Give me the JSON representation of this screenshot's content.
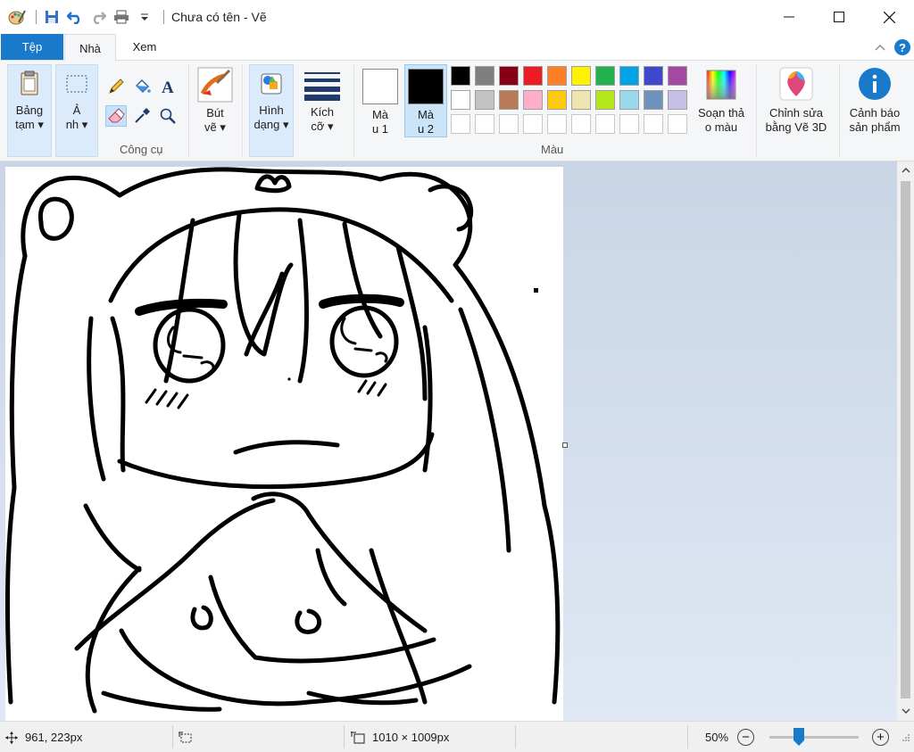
{
  "window": {
    "title": "Chưa có tên - Vẽ"
  },
  "tabs": {
    "file": "Tệp",
    "home": "Nhà",
    "view": "Xem"
  },
  "ribbon": {
    "clipboard": {
      "line1": "Bảng",
      "line2": "tạm"
    },
    "image": {
      "line1": "Ả",
      "line2": "nh"
    },
    "tools_label": "Công cụ",
    "brushes": {
      "line1": "Bút",
      "line2": "vẽ"
    },
    "shapes": {
      "line1": "Hình",
      "line2": "dạng"
    },
    "size": {
      "line1": "Kích",
      "line2": "cỡ"
    },
    "color1": {
      "line1": "Mà",
      "line2": "u 1",
      "value": "#ffffff"
    },
    "color2": {
      "line1": "Mà",
      "line2": "u 2",
      "value": "#000000"
    },
    "colors_label": "Màu",
    "edit_colors": {
      "line1": "Soạn thả",
      "line2": "o màu"
    },
    "edit_3d": {
      "line1": "Chỉnh sửa",
      "line2": "bằng Vẽ 3D"
    },
    "product_alert": {
      "line1": "Cảnh báo",
      "line2": "sản phẩm"
    },
    "palette_row1": [
      "#000000",
      "#7f7f7f",
      "#880015",
      "#ed1c24",
      "#ff7f27",
      "#fff200",
      "#22b14c",
      "#00a2e8",
      "#3f48cc",
      "#a349a4"
    ],
    "palette_row2": [
      "#ffffff",
      "#c3c3c3",
      "#b97a57",
      "#ffaec9",
      "#ffc90e",
      "#efe4b0",
      "#b5e61d",
      "#99d9ea",
      "#7092be",
      "#c8bfe7"
    ],
    "palette_row3": [
      "#ffffff",
      "#ffffff",
      "#ffffff",
      "#ffffff",
      "#ffffff",
      "#ffffff",
      "#ffffff",
      "#ffffff",
      "#ffffff",
      "#ffffff"
    ]
  },
  "status": {
    "cursor_position": "961, 223px",
    "selection_size": "",
    "image_size": "1010 × 1009px",
    "zoom": "50%",
    "zoom_level": 0.5
  }
}
